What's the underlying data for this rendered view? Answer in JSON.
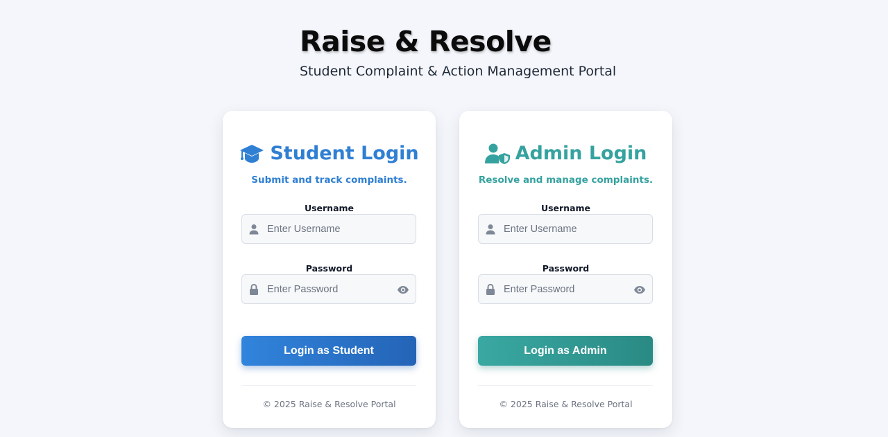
{
  "header": {
    "title": "Raise & Resolve",
    "subtitle": "Student Complaint & Action Management Portal"
  },
  "student_card": {
    "icon": "graduation-cap-icon",
    "title": "Student Login",
    "subtitle": "Submit and track complaints.",
    "username_label": "Username",
    "username_placeholder": "Enter Username",
    "username_value": "",
    "password_label": "Password",
    "password_placeholder": "Enter Password",
    "password_value": "",
    "button_label": "Login as Student",
    "footer": "© 2025 Raise & Resolve Portal",
    "accent_color": "#2f7fd3"
  },
  "admin_card": {
    "icon": "user-shield-icon",
    "title": "Admin Login",
    "subtitle": "Resolve and manage complaints.",
    "username_label": "Username",
    "username_placeholder": "Enter Username",
    "username_value": "",
    "password_label": "Password",
    "password_placeholder": "Enter Password",
    "password_value": "",
    "button_label": "Login as Admin",
    "footer": "© 2025 Raise & Resolve Portal",
    "accent_color": "#35a29f"
  },
  "icons": {
    "username_field": "user-icon",
    "password_field": "lock-icon",
    "password_toggle": "eye-icon"
  },
  "colors": {
    "background": "#f4f6fb",
    "student_button": "#2a72c8",
    "admin_button": "#32998f"
  }
}
